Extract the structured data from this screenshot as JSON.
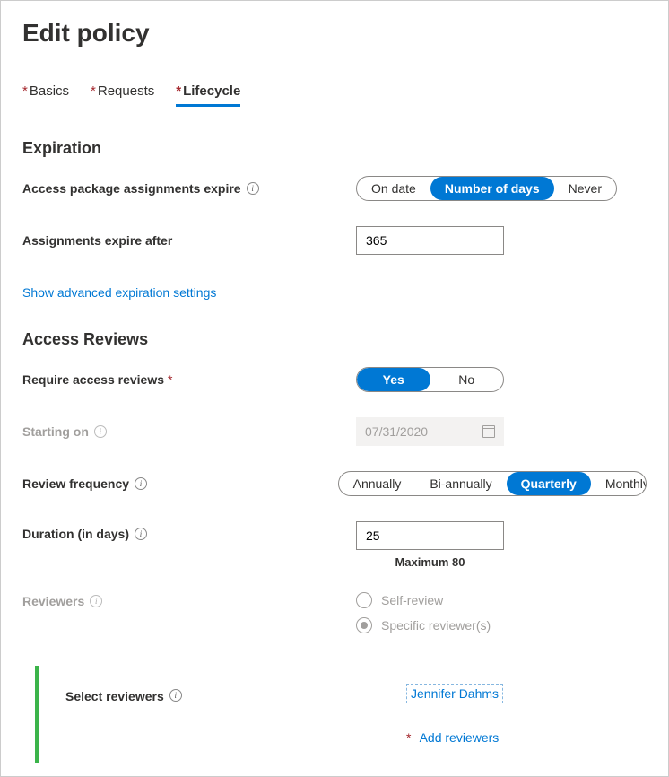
{
  "page_title": "Edit policy",
  "tabs": {
    "basics": "Basics",
    "requests": "Requests",
    "lifecycle": "Lifecycle"
  },
  "expiration": {
    "heading": "Expiration",
    "assign_expire_label": "Access package assignments expire",
    "seg_on_date": "On date",
    "seg_days": "Number of days",
    "seg_never": "Never",
    "after_label": "Assignments expire after",
    "after_value": "365",
    "advanced_link": "Show advanced expiration settings"
  },
  "reviews": {
    "heading": "Access Reviews",
    "require_label": "Require access reviews",
    "seg_yes": "Yes",
    "seg_no": "No",
    "start_label": "Starting on",
    "start_value": "07/31/2020",
    "freq_label": "Review frequency",
    "seg_annually": "Annually",
    "seg_biannually": "Bi-annually",
    "seg_quarterly": "Quarterly",
    "seg_monthly": "Monthly",
    "duration_label": "Duration (in days)",
    "duration_value": "25",
    "duration_hint": "Maximum 80",
    "reviewers_label": "Reviewers",
    "radio_self": "Self-review",
    "radio_specific": "Specific reviewer(s)",
    "select_reviewers_label": "Select reviewers",
    "reviewer_name": "Jennifer Dahms",
    "add_reviewers": "Add reviewers"
  }
}
